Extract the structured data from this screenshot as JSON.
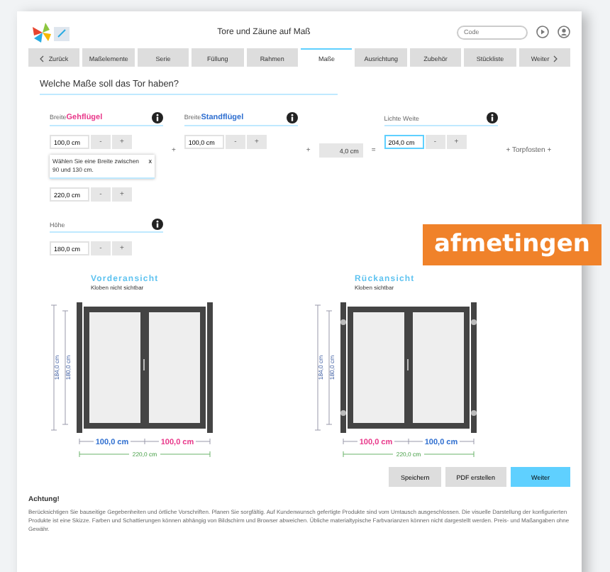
{
  "header": {
    "title": "Tore und Zäune auf Maß",
    "search_placeholder": "Code"
  },
  "tabs": [
    {
      "label": "Zurück",
      "kind": "back",
      "selected": false
    },
    {
      "label": "Maßelemente",
      "kind": "step",
      "selected": false
    },
    {
      "label": "Serie",
      "kind": "step",
      "selected": false
    },
    {
      "label": "Füllung",
      "kind": "step",
      "selected": false
    },
    {
      "label": "Rahmen",
      "kind": "step",
      "selected": false
    },
    {
      "label": "Maße",
      "kind": "step",
      "selected": true
    },
    {
      "label": "Ausrichtung",
      "kind": "step",
      "selected": false
    },
    {
      "label": "Zubehör",
      "kind": "step",
      "selected": false
    },
    {
      "label": "Stückliste",
      "kind": "step",
      "selected": false
    },
    {
      "label": "Weiter",
      "kind": "next",
      "selected": false
    }
  ],
  "heading": "Welche Maße soll das Tor haben?",
  "row": [
    {
      "kind": "field",
      "label": "Breite",
      "highlight": "Gehflügel",
      "color": "#e8388a",
      "value": "100,0 cm",
      "minus": "-",
      "plus": "+"
    },
    {
      "kind": "operator",
      "text": "+"
    },
    {
      "kind": "field",
      "label": "Breite",
      "highlight": "Standflügel",
      "color": "#2f6fd0",
      "value": "100,0 cm",
      "minus": "-",
      "plus": "+"
    },
    {
      "kind": "operator",
      "text": "+"
    },
    {
      "kind": "static",
      "value": "4,0 cm"
    },
    {
      "kind": "operator",
      "text": "="
    },
    {
      "kind": "field",
      "label": "Lichte Weite",
      "value": "204,0 cm",
      "minus": "-",
      "plus": "+"
    },
    {
      "kind": "operator",
      "text": "+ Torpfosten +"
    }
  ],
  "tooltip": {
    "text": "Wählen Sie eine Breite zwischen 90 und 130 cm.",
    "close": "x"
  },
  "total_field": {
    "value": "220,0 cm",
    "minus": "-",
    "plus": "+"
  },
  "height_field": {
    "label": "Höhe",
    "value": "180,0 cm",
    "minus": "-",
    "plus": "+"
  },
  "views": [
    {
      "kind": "front",
      "title": "Vorderansicht",
      "subtitle": "Kloben nicht sichtbar",
      "height_outer": "184,0 cm",
      "height_inner": "180,0 cm",
      "segments": [
        {
          "text": "100,0 cm",
          "color": "#2f6fd0"
        },
        {
          "text": "100,0 cm",
          "color": "#e8388a"
        }
      ],
      "total": "220,0 cm"
    },
    {
      "kind": "back",
      "title": "Rückansicht",
      "subtitle": "Kloben sichtbar",
      "height_outer": "184,0 cm",
      "height_inner": "180,0 cm",
      "segments": [
        {
          "text": "100,0 cm",
          "color": "#e8388a"
        },
        {
          "text": "100,0 cm",
          "color": "#2f6fd0"
        }
      ],
      "total": "220,0 cm"
    }
  ],
  "buttons": [
    {
      "label": "Speichern",
      "kind": "secondary"
    },
    {
      "label": "PDF erstellen",
      "kind": "secondary"
    },
    {
      "label": "Weiter",
      "kind": "primary"
    }
  ],
  "notice": {
    "title": "Achtung!",
    "text": "Berücksichtigen Sie bauseitige Gegebenheiten und örtliche Vorschriften. Planen Sie sorgfältig. Auf Kundenwunsch gefertigte Produkte sind vom Umtausch ausgeschlossen. Die visuelle Darstellung der konfigurierten Produkte ist eine Skizze. Farben und Schattierungen können abhängig von Bildschirm und Browser abweichen. Übliche materialtypische Farbvarianzen können nicht dargestellt werden. Preis- und Maßangaben ohne Gewähr."
  },
  "badge": "afmetingen"
}
